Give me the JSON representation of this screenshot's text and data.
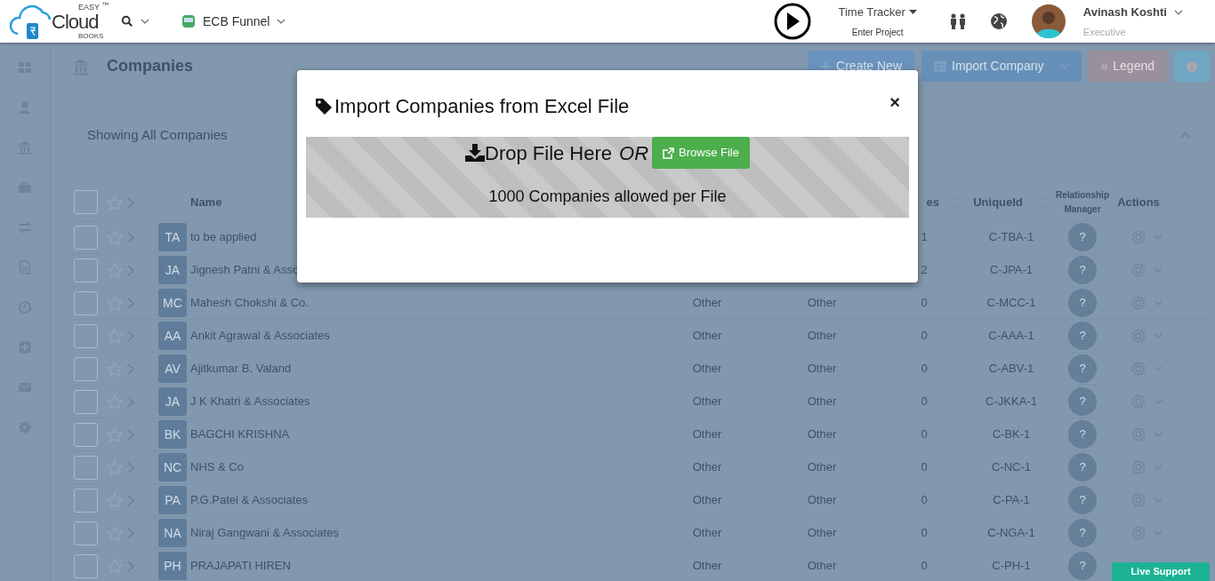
{
  "brand": {
    "top": "EASY",
    "name": "Cloud",
    "bottom": "BOOKS",
    "mark": "™"
  },
  "nav": {
    "funnel": "ECB Funnel",
    "tracker": {
      "title": "Time Tracker",
      "project": "Enter Project"
    },
    "user": {
      "name": "Avinash Koshti",
      "role": "Executive"
    }
  },
  "sidebar": {
    "items": [
      {
        "kind": "dashboard"
      },
      {
        "kind": "user"
      },
      {
        "kind": "bank"
      },
      {
        "kind": "briefcase"
      },
      {
        "kind": "exchange"
      },
      {
        "kind": "file"
      },
      {
        "kind": "clock"
      },
      {
        "kind": "plus"
      },
      {
        "kind": "mail"
      },
      {
        "kind": "gear"
      }
    ]
  },
  "page": {
    "title": "Companies",
    "buttons": [
      {
        "kind": "create",
        "label": "Create New"
      },
      {
        "kind": "import",
        "label": "Import Company"
      },
      {
        "kind": "legend",
        "label": "Legend"
      },
      {
        "kind": "info"
      }
    ]
  },
  "filter": {
    "label": "Showing All Companies",
    "expanded": true
  },
  "table": {
    "select_all": false,
    "columns": [
      {
        "label": "Name"
      },
      {
        "label": "es",
        "sortable": true
      },
      {
        "label": "UniqueId",
        "sortable": true
      },
      {
        "label": "Relationship Manager"
      },
      {
        "label": "Actions"
      }
    ],
    "rows": [
      {
        "checked": false,
        "starred": false,
        "initials": "TA",
        "name": "to be applied",
        "count": "1",
        "unique_id": "C-TBA-1",
        "manager": "?"
      },
      {
        "checked": false,
        "starred": false,
        "initials": "JA",
        "name": "Jignesh Patni & Asso",
        "count": "2",
        "unique_id": "C-JPA-1",
        "manager": "?"
      },
      {
        "checked": false,
        "starred": false,
        "initials": "MC",
        "name": "Mahesh Chokshi & Co.",
        "type": "Other",
        "category": "Other",
        "count": "0",
        "unique_id": "C-MCC-1",
        "manager": "?"
      },
      {
        "checked": false,
        "starred": false,
        "initials": "AA",
        "name": "Ankit Agrawal & Associates",
        "type": "Other",
        "category": "Other",
        "count": "0",
        "unique_id": "C-AAA-1",
        "manager": "?"
      },
      {
        "checked": false,
        "starred": false,
        "initials": "AV",
        "name": "Ajitkumar B. Valand",
        "type": "Other",
        "category": "Other",
        "count": "0",
        "unique_id": "C-ABV-1",
        "manager": "?"
      },
      {
        "checked": false,
        "starred": false,
        "initials": "JA",
        "name": "J K Khatri & Associates",
        "type": "Other",
        "category": "Other",
        "count": "0",
        "unique_id": "C-JKKA-1",
        "manager": "?"
      },
      {
        "checked": false,
        "starred": false,
        "initials": "BK",
        "name": "BAGCHI KRISHNA",
        "type": "Other",
        "category": "Other",
        "count": "0",
        "unique_id": "C-BK-1",
        "manager": "?"
      },
      {
        "checked": false,
        "starred": false,
        "initials": "NC",
        "name": "NHS & Co",
        "type": "Other",
        "category": "Other",
        "count": "0",
        "unique_id": "C-NC-1",
        "manager": "?"
      },
      {
        "checked": false,
        "starred": false,
        "initials": "PA",
        "name": "P.G.Patel & Associates",
        "type": "Other",
        "category": "Other",
        "count": "0",
        "unique_id": "C-PA-1",
        "manager": "?"
      },
      {
        "checked": false,
        "starred": false,
        "initials": "NA",
        "name": "Niraj Gangwani & Associates",
        "type": "Other",
        "category": "Other",
        "count": "0",
        "unique_id": "C-NGA-1",
        "manager": "?"
      },
      {
        "checked": false,
        "starred": false,
        "initials": "PH",
        "name": "PRAJAPATI HIREN",
        "type": "Other",
        "category": "Other",
        "count": "0",
        "unique_id": "C-PH-1",
        "manager": "?"
      }
    ]
  },
  "modal": {
    "title": "Import Companies from Excel File",
    "close": "×",
    "drop_text": "Drop File Here",
    "or_text": "OR",
    "browse": "Browse File",
    "note": "1000 Companies allowed per File"
  },
  "live_support": "Live Support"
}
